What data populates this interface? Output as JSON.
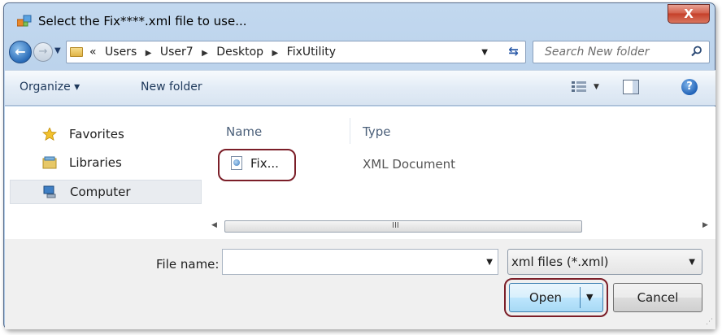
{
  "window": {
    "title": "Select the Fix****.xml file to use...",
    "close_label": "X"
  },
  "address": {
    "overflow": "«",
    "breadcrumbs": [
      "Users",
      "User7",
      "Desktop",
      "FixUtility"
    ],
    "search_placeholder": "Search New folder"
  },
  "toolbar": {
    "organize_label": "Organize ▾",
    "new_folder_label": "New folder",
    "help_label": "?"
  },
  "nav": {
    "items": [
      {
        "label": "Favorites",
        "icon": "star-icon"
      },
      {
        "label": "Libraries",
        "icon": "library-icon"
      },
      {
        "label": "Computer",
        "icon": "computer-icon",
        "selected": true
      }
    ]
  },
  "files": {
    "columns": [
      "Name",
      "Type"
    ],
    "rows": [
      {
        "name": "Fix...",
        "type": "XML Document",
        "icon": "xml-file-icon"
      }
    ],
    "scroll_grip": "III"
  },
  "bottom": {
    "file_name_label": "File name:",
    "file_name_value": "",
    "filter_value": "xml files (*.xml)",
    "open_label": "Open",
    "cancel_label": "Cancel"
  },
  "colors": {
    "highlight": "#7b1e28",
    "chrome": "#b6cee8",
    "accent": "#2a6cb8"
  }
}
